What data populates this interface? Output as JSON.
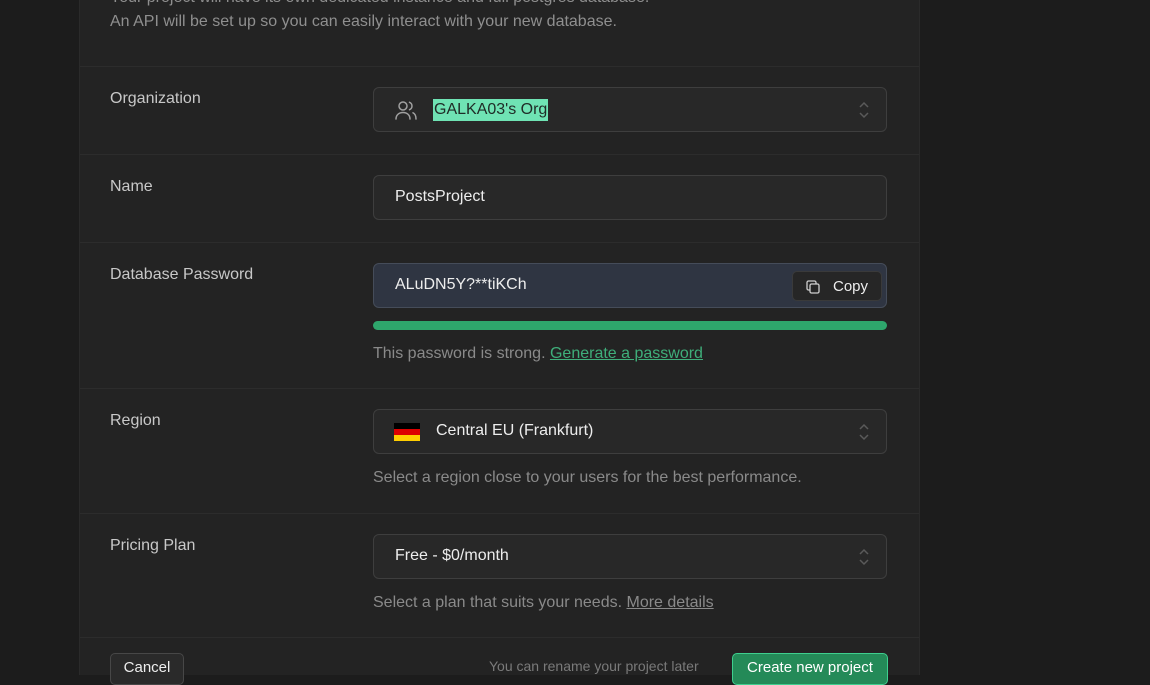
{
  "intro": {
    "line1": "Your project will have its own dedicated instance and full postgres database.",
    "line2": "An API will be set up so you can easily interact with your new database."
  },
  "organization": {
    "label": "Organization",
    "value": "GALKA03's Org",
    "icon": "users-icon"
  },
  "name": {
    "label": "Name",
    "value": "PostsProject"
  },
  "password": {
    "label": "Database Password",
    "value": "ALuDN5Y?**tiKCh",
    "copy_label": "Copy",
    "strength_fraction": 1.0,
    "strength_color": "#2ea66c",
    "help_text": "This password is strong.",
    "generate_link": "Generate a password"
  },
  "region": {
    "label": "Region",
    "value": "Central EU (Frankfurt)",
    "flag": "germany-flag",
    "help_text": "Select a region close to your users for the best performance."
  },
  "pricing": {
    "label": "Pricing Plan",
    "value": "Free - $0/month",
    "help_text": "Select a plan that suits your needs.",
    "details_link": "More details"
  },
  "footer": {
    "cancel_label": "Cancel",
    "rename_note": "You can rename your project later",
    "create_label": "Create new project"
  },
  "colors": {
    "accent": "#3ecf8e",
    "background": "#1c1c1c",
    "panel": "#232323"
  }
}
